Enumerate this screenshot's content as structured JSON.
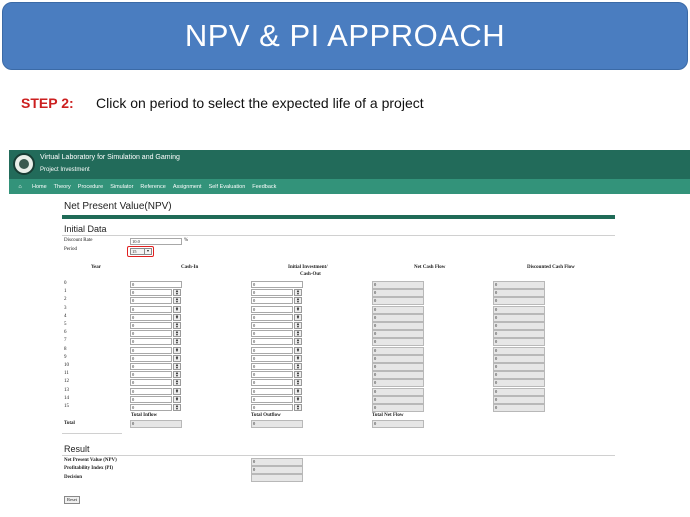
{
  "slide": {
    "banner_title": "NPV & PI APPROACH",
    "step_label": "STEP 2:",
    "step_text": "Click on period to select the expected life of a project"
  },
  "app": {
    "title": "Virtual Laboratory for Simulation and Gaming",
    "subtitle": "Project Investment",
    "nav": [
      "Home",
      "Theory",
      "Procedure",
      "Simulator",
      "Reference",
      "Assignment",
      "Self Evaluation",
      "Feedback"
    ],
    "header_color": "#226b5a",
    "nav_color": "#33937a"
  },
  "page": {
    "title": "Net Present Value(NPV)",
    "initial_heading": "Initial Data",
    "discount_label": "Discount Rate",
    "discount_value": "10.0",
    "percent_sign": "%",
    "period_label": "Period",
    "period_value": "15"
  },
  "table": {
    "headers": {
      "year": "Year",
      "cash_in": "Cash-In",
      "initial_investment": "Initial Investment/",
      "cash_out": "Cash-Out",
      "net_cash_flow": "Net Cash Flow",
      "discounted": "Discounted Cash Flow"
    },
    "years": [
      "0",
      "1",
      "2",
      "3",
      "4",
      "5",
      "6",
      "7",
      "8",
      "9",
      "10",
      "11",
      "12",
      "13",
      "14",
      "15"
    ],
    "cell_value": "0",
    "total_inflow_label": "Total Inflow",
    "total_outflow_label": "Total Outflow",
    "total_net_label": "Total Net Flow",
    "total_label": "Total",
    "total_inflow": "0",
    "total_outflow": "0",
    "total_net": "0"
  },
  "result": {
    "heading": "Result",
    "npv_label": "Net Present Value (NPV)",
    "pi_label": "Profitability Index (PI)",
    "decision_label": "Decision",
    "npv_value": "0",
    "pi_value": "0",
    "decision_value": ""
  },
  "reset_label": "Reset"
}
